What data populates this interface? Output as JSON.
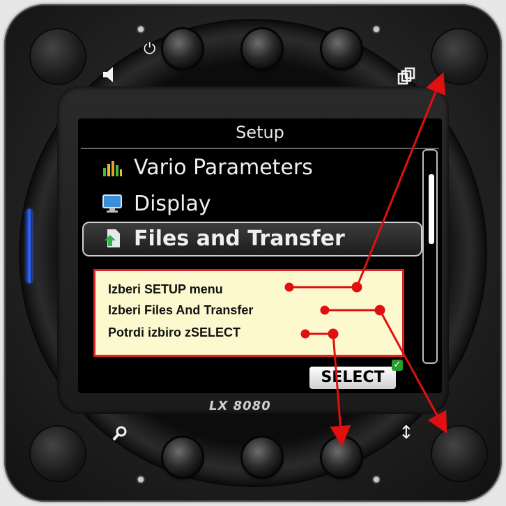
{
  "screen": {
    "title": "Setup",
    "menu_items": [
      {
        "label": "Vario Parameters",
        "icon": "vario-bars-icon"
      },
      {
        "label": "Display",
        "icon": "monitor-icon"
      },
      {
        "label": "Files and Transfer",
        "icon": "files-transfer-icon",
        "selected": true
      }
    ],
    "select_label": "SELECT",
    "select_check": "✓"
  },
  "callout": {
    "lines": [
      "Izberi SETUP menu",
      "Izberi Files And Transfer",
      "Potrdi izbiro zSELECT"
    ],
    "border_color": "#dd2222",
    "background": "#fdf9cf"
  },
  "device": {
    "brand": "LX 8080",
    "symbols": {
      "power": "⏻",
      "volume": "speaker-icon",
      "pages": "pages-icon",
      "zoom": "magnifier-icon",
      "updown": "↕"
    },
    "accent_led": "#3a6cff"
  }
}
